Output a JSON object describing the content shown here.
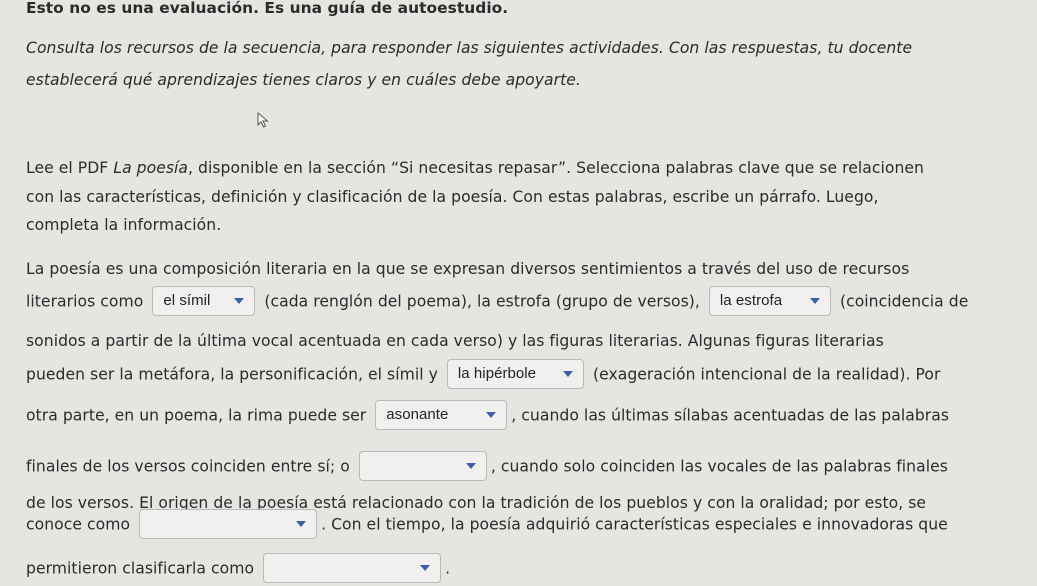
{
  "heading": "Esto no es una evaluación. Es una guía de autoestudio.",
  "intro": {
    "line1": "Consulta los recursos de la secuencia, para responder las siguientes actividades. Con las respuestas, tu docente",
    "line2": "establecerá qué aprendizajes tienes claros y en cuáles debe apoyarte."
  },
  "instructions": {
    "l1_pre": "Lee el PDF ",
    "l1_title": "La poesía",
    "l1_post": ", disponible en la sección “Si necesitas repasar”. Selecciona palabras clave que se relacionen",
    "line2": "con las características, definición y clasificación de la poesía. Con estas palabras, escribe un párrafo. Luego,",
    "line3": "completa la información."
  },
  "paragraph": {
    "l1": "La poesía es una composición literaria en la que se expresan diversos sentimientos a través del uso de recursos",
    "l2_a": "literarios como",
    "l2_b": "(cada renglón del poema), la estrofa (grupo de versos),",
    "l2_c": "(coincidencia de",
    "l3": "sonidos a partir de la última vocal acentuada en cada verso) y las figuras literarias. Algunas figuras literarias",
    "l4_a": "pueden ser la metáfora, la personificación, el símil y",
    "l4_b": "(exageración intencional de la realidad). Por",
    "l5_a": "otra parte, en un poema, la rima puede ser",
    "l5_b": ", cuando las últimas sílabas acentuadas de las palabras",
    "l6_a": "finales de los versos coinciden entre sí; o",
    "l6_b": ", cuando solo coinciden las vocales de las palabras finales",
    "l7": "de los versos. El origen de la poesía está relacionado con la tradición de los pueblos y con la oralidad; por esto, se",
    "l8_a": "conoce como",
    "l8_b": ". Con el tiempo, la poesía adquirió características especiales e innovadoras que",
    "l9_a": "permitieron clasificarla como",
    "l9_b": "."
  },
  "dropdowns": {
    "d1": "el símil",
    "d2": "la estrofa",
    "d3": "la hipérbole",
    "d4": "asonante",
    "d5": "",
    "d6": "",
    "d7": ""
  },
  "icons": {
    "dropdown_caret": "triangle-down-icon",
    "cursor": "mouse-pointer-icon"
  },
  "colors": {
    "caret": "#3b5fa8",
    "background": "#e7e5e2"
  }
}
